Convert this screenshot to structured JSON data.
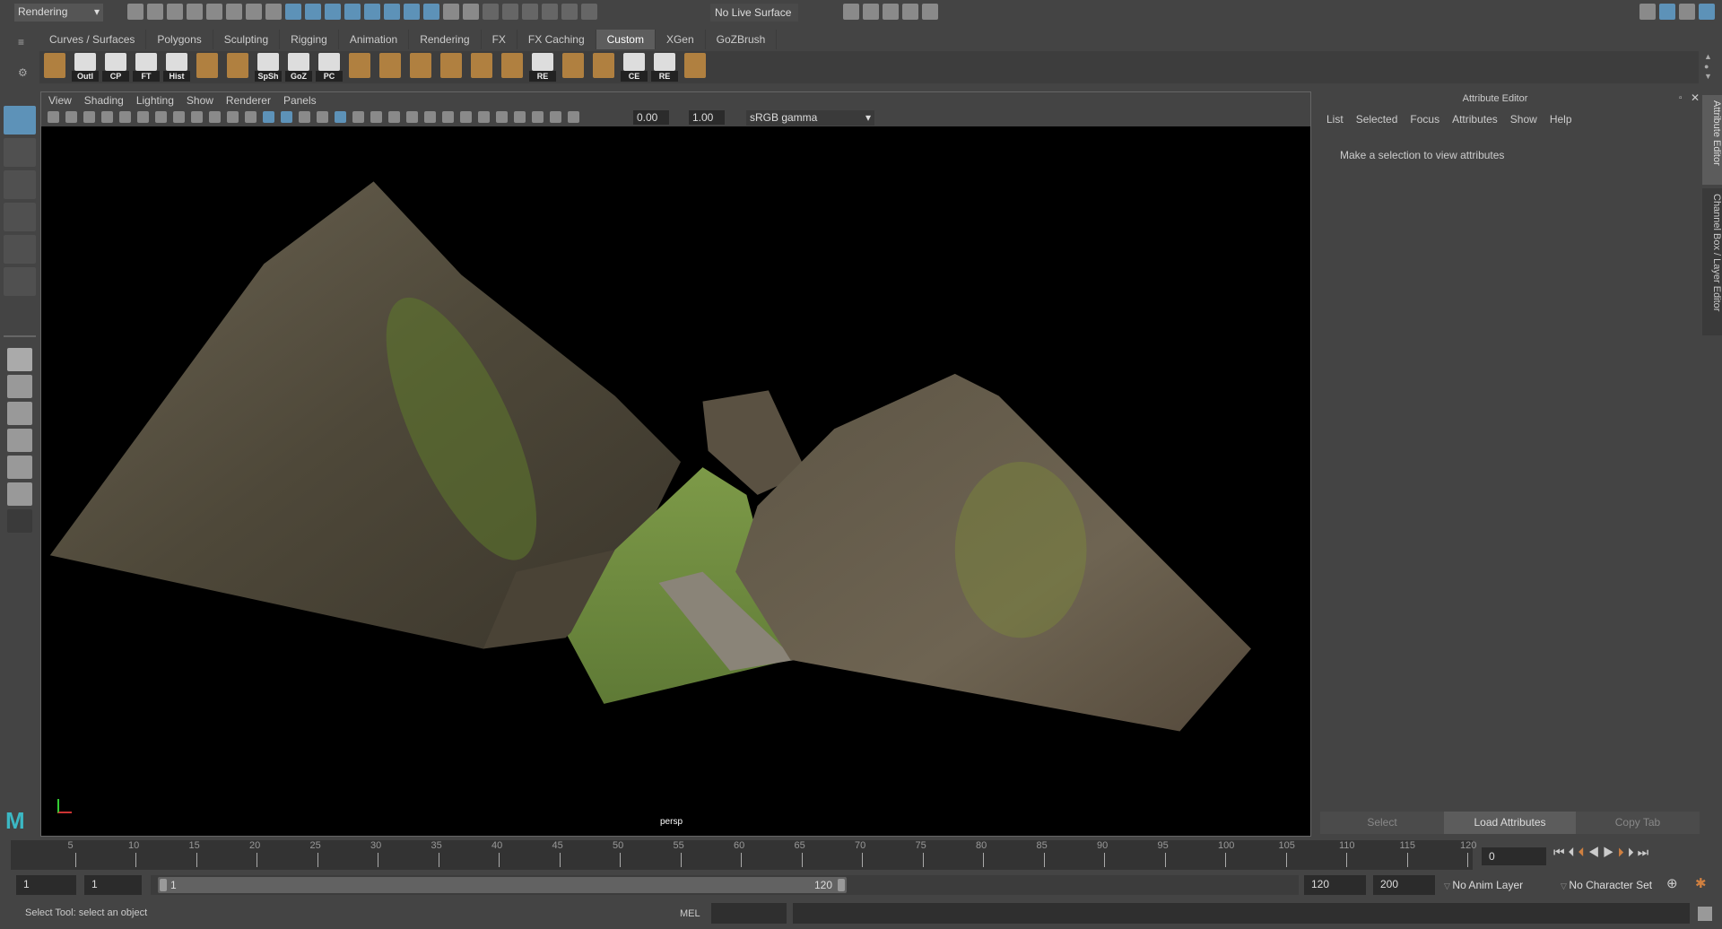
{
  "status_line": {
    "mode": "Rendering",
    "live_surface": "No Live Surface",
    "icons": [
      "new-scene",
      "open-scene",
      "save-scene",
      "undo",
      "redo",
      "select-hierarchy",
      "select-object",
      "select-component",
      "snap-grid",
      "snap-curve",
      "snap-point",
      "snap-plane",
      "snap-surface",
      "snap-view",
      "render-settings",
      "help",
      "lock",
      "select-lock",
      "sym1",
      "sym2",
      "sym3",
      "sym4",
      "sym5",
      "sym6"
    ],
    "render_icons": [
      "render-view",
      "render-frame",
      "ipr-render",
      "render-settings",
      "hypershade"
    ],
    "right_icons": [
      "workspace-1",
      "workspace-2",
      "workspace-3",
      "workspace-4"
    ]
  },
  "shelf": {
    "tabs": [
      "Curves / Surfaces",
      "Polygons",
      "Sculpting",
      "Rigging",
      "Animation",
      "Rendering",
      "FX",
      "FX Caching",
      "Custom",
      "XGen",
      "GoZBrush"
    ],
    "active": "Custom",
    "items": [
      {
        "name": "paint",
        "label": ""
      },
      {
        "name": "outliner",
        "label": "Outl"
      },
      {
        "name": "cp",
        "label": "CP"
      },
      {
        "name": "ft",
        "label": "FT"
      },
      {
        "name": "history",
        "label": "Hist"
      },
      {
        "name": "layer-a",
        "label": ""
      },
      {
        "name": "layer-b",
        "label": ""
      },
      {
        "name": "spreadsheet",
        "label": "SpSh"
      },
      {
        "name": "goz",
        "label": "GoZ"
      },
      {
        "name": "pc",
        "label": "PC"
      },
      {
        "name": "checker",
        "label": ""
      },
      {
        "name": "node-a",
        "label": ""
      },
      {
        "name": "link-a",
        "label": ""
      },
      {
        "name": "link-b",
        "label": ""
      },
      {
        "name": "link-c",
        "label": ""
      },
      {
        "name": "link-d",
        "label": ""
      },
      {
        "name": "folder-re",
        "label": "RE"
      },
      {
        "name": "stamp",
        "label": ""
      },
      {
        "name": "blocks",
        "label": ""
      },
      {
        "name": "ce",
        "label": "CE"
      },
      {
        "name": "folder-re2",
        "label": "RE"
      },
      {
        "name": "cleanup",
        "label": ""
      }
    ]
  },
  "viewport": {
    "menu": [
      "View",
      "Shading",
      "Lighting",
      "Show",
      "Renderer",
      "Panels"
    ],
    "exposure": "0.00",
    "gamma": "1.00",
    "color_space": "sRGB gamma",
    "camera": "persp"
  },
  "attribute_editor": {
    "title": "Attribute Editor",
    "menu": [
      "List",
      "Selected",
      "Focus",
      "Attributes",
      "Show",
      "Help"
    ],
    "message": "Make a selection to view attributes",
    "buttons": [
      "Select",
      "Load Attributes",
      "Copy Tab"
    ],
    "side_tabs": [
      "Attribute Editor",
      "Channel Box / Layer Editor"
    ]
  },
  "timeline": {
    "ticks": [
      "5",
      "10",
      "15",
      "20",
      "25",
      "30",
      "35",
      "40",
      "45",
      "50",
      "55",
      "60",
      "65",
      "70",
      "75",
      "80",
      "85",
      "90",
      "95",
      "100",
      "105",
      "110",
      "115",
      "120"
    ],
    "current_frame": "0"
  },
  "range": {
    "start": "1",
    "playback_start": "1",
    "slider_start": "1",
    "slider_end": "120",
    "playback_end": "120",
    "end": "200",
    "anim_layer": "No Anim Layer",
    "character_set": "No Character Set"
  },
  "command": {
    "help_line": "Select Tool: select an object",
    "lang": "MEL"
  },
  "colors": {
    "accent": "#5d92b8",
    "bg": "#444444",
    "viewport": "#000000"
  }
}
